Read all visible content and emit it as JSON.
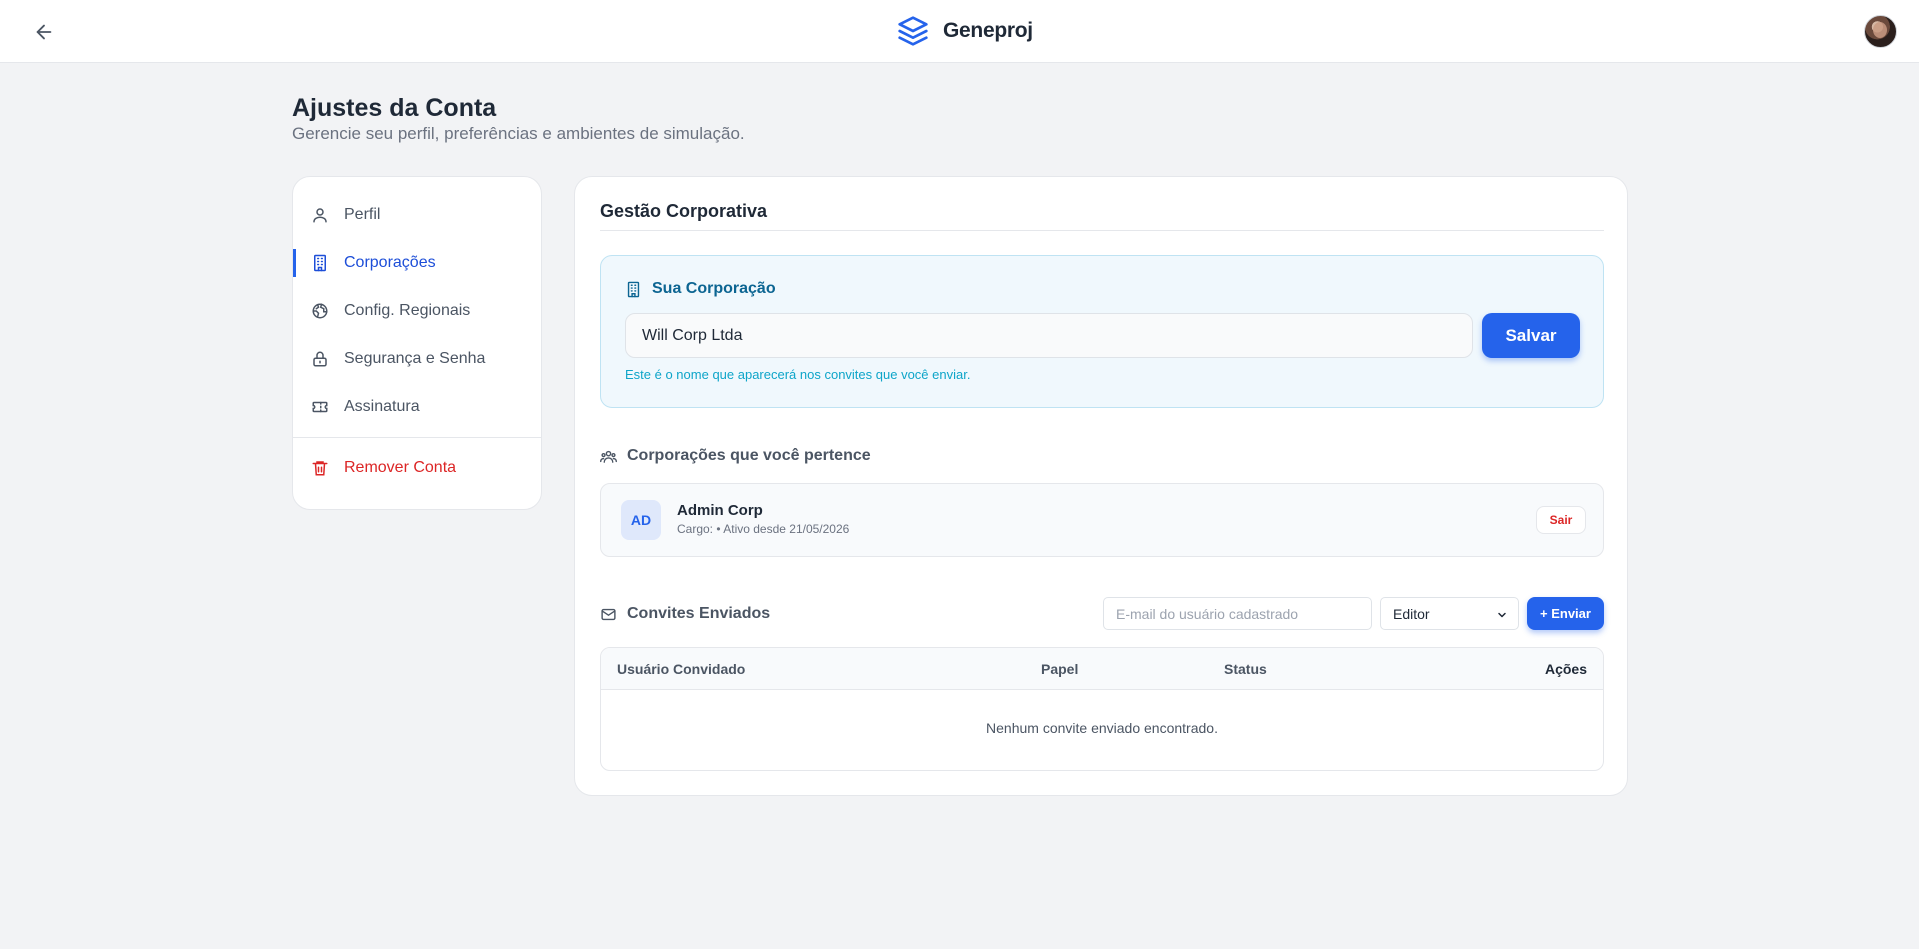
{
  "app": {
    "name": "Geneproj"
  },
  "header": {
    "back_icon": "arrow-left-icon",
    "logo_icon": "layers-icon"
  },
  "page": {
    "title": "Ajustes da Conta",
    "subtitle": "Gerencie seu perfil, preferências e ambientes de simulação."
  },
  "sidebar": {
    "items": [
      {
        "label": "Perfil",
        "icon": "user-icon",
        "active": false
      },
      {
        "label": "Corporações",
        "icon": "building-icon",
        "active": true
      },
      {
        "label": "Config. Regionais",
        "icon": "globe-icon",
        "active": false
      },
      {
        "label": "Segurança e Senha",
        "icon": "lock-icon",
        "active": false
      },
      {
        "label": "Assinatura",
        "icon": "ticket-icon",
        "active": false
      }
    ],
    "danger_item": {
      "label": "Remover Conta",
      "icon": "trash-icon"
    }
  },
  "main": {
    "section_title": "Gestão Corporativa",
    "your_corp": {
      "title": "Sua Corporação",
      "name_value": "Will Corp Ltda",
      "save_label": "Salvar",
      "hint": "Este é o nome que aparecerá nos convites que você enviar."
    },
    "memberships": {
      "title": "Corporações que você pertence",
      "items": [
        {
          "initials": "AD",
          "name": "Admin Corp",
          "meta": "Cargo: • Ativo desde 21/05/2026",
          "leave_label": "Sair"
        }
      ]
    },
    "invites": {
      "title": "Convites Enviados",
      "email_placeholder": "E-mail do usuário cadastrado",
      "role_selected": "Editor",
      "send_label": "+ Enviar",
      "columns": [
        "Usuário Convidado",
        "Papel",
        "Status",
        "Ações"
      ],
      "empty_text": "Nenhum convite enviado encontrado."
    }
  },
  "colors": {
    "accent": "#2563eb",
    "danger": "#dc2626",
    "info_bg": "#f0f8fd",
    "info_text": "#0c6592"
  }
}
